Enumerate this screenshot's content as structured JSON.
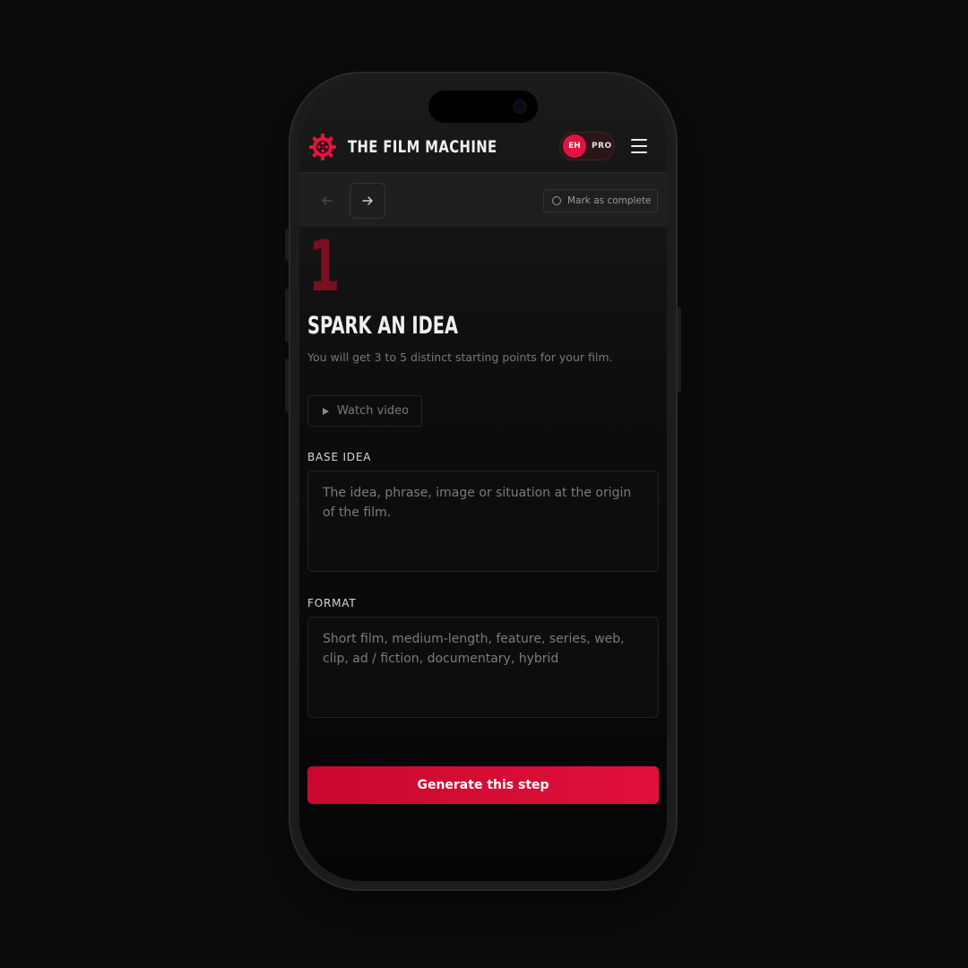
{
  "header": {
    "brand": "THE FILM MACHINE",
    "avatar_initials": "EH",
    "plan_label": "PRO"
  },
  "toolbar": {
    "mark_complete_label": "Mark as complete"
  },
  "step": {
    "number": "1",
    "title": "SPARK AN IDEA",
    "description": "You will get 3 to 5 distinct starting points for your film.",
    "watch_video_label": "Watch video"
  },
  "fields": {
    "base_idea": {
      "label": "BASE IDEA",
      "placeholder": "The idea, phrase, image or situation at the origin of the film."
    },
    "format": {
      "label": "FORMAT",
      "placeholder": "Short film, medium-length, feature, series, web, clip, ad / fiction, documentary, hybrid"
    }
  },
  "generate_label": "Generate this step",
  "colors": {
    "accent": "#e3123f",
    "step_number": "#7a0f22",
    "background": "#0c0c0d"
  }
}
